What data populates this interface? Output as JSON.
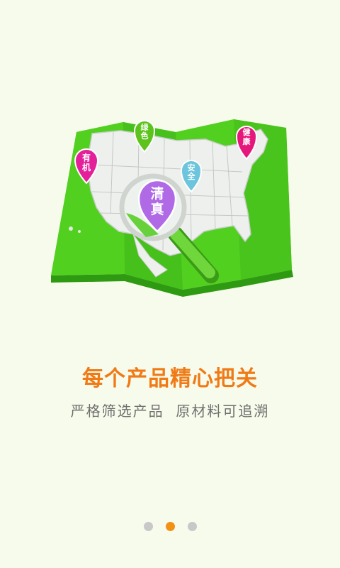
{
  "onboarding": {
    "headline": "每个产品精心把关",
    "subtitle": "严格筛选产品  原材料可追溯",
    "page_indicator": {
      "pages": 3,
      "current_index": 1
    }
  },
  "map_pins": {
    "organic": {
      "line1": "有",
      "line2": "机"
    },
    "green": {
      "line1": "绿",
      "line2": "色"
    },
    "safe": {
      "line1": "安",
      "line2": "全"
    },
    "healthy": {
      "line1": "健",
      "line2": "康"
    },
    "halal": {
      "line1": "清",
      "line2": "真"
    }
  },
  "colors": {
    "background": "#f7fbeb",
    "map_green": "#4fcf1f",
    "headline_orange": "#f07a16",
    "subtitle_gray": "#6e6e6e",
    "dot_active": "#f39114",
    "dot_inactive": "#c8c8c8",
    "pin_magenta": "#e41f9a",
    "pin_green": "#5cc21c",
    "pin_blue": "#6cc5dc",
    "pin_pink": "#e6177a",
    "pin_purple": "#b06ae6"
  }
}
